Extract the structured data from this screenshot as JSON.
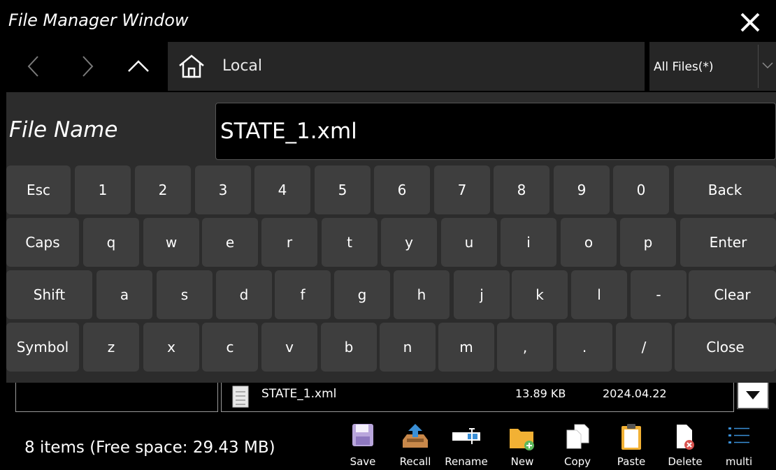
{
  "window": {
    "title": "File Manager Window"
  },
  "nav": {
    "path": "Local",
    "filter": "All Files(*)"
  },
  "filename": {
    "label": "File Name",
    "value": "STATE_1.xml"
  },
  "keyboard": {
    "row1": [
      "Esc",
      "1",
      "2",
      "3",
      "4",
      "5",
      "6",
      "7",
      "8",
      "9",
      "0",
      "Back"
    ],
    "row2": [
      "Caps",
      "q",
      "w",
      "e",
      "r",
      "t",
      "y",
      "u",
      "i",
      "o",
      "p",
      "Enter"
    ],
    "row3": [
      "Shift",
      "a",
      "s",
      "d",
      "f",
      "g",
      "h",
      "j",
      "k",
      "l",
      "-",
      "Clear"
    ],
    "row4": [
      "Symbol",
      "z",
      "x",
      "c",
      "v",
      "b",
      "n",
      "m",
      ",",
      ".",
      "/",
      "Close"
    ]
  },
  "file": {
    "name": "STATE_1.xml",
    "size": "13.89 KB",
    "date": "2024.04.22"
  },
  "status": {
    "text": "8 items (Free space: 29.43 MB)"
  },
  "toolbar": {
    "save": "Save",
    "recall": "Recall",
    "rename": "Rename",
    "new": "New",
    "copy": "Copy",
    "paste": "Paste",
    "delete": "Delete",
    "multi": "multi"
  },
  "colors": {
    "panel": "#2c2c2c",
    "key": "#3e3e3e",
    "folder": "#f2b134",
    "accent": "#3a8fd6"
  }
}
